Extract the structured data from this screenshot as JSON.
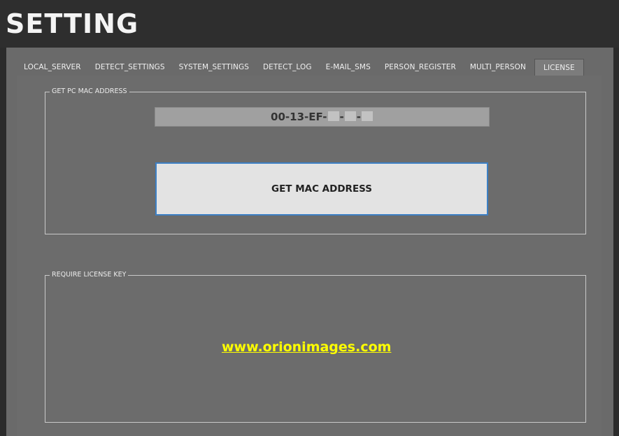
{
  "app": {
    "title": "SETTING"
  },
  "tabs": [
    {
      "label": "LOCAL_SERVER"
    },
    {
      "label": "DETECT_SETTINGS"
    },
    {
      "label": "SYSTEM_SETTINGS"
    },
    {
      "label": "DETECT_LOG"
    },
    {
      "label": "E-MAIL_SMS"
    },
    {
      "label": "PERSON_REGISTER"
    },
    {
      "label": "MULTI_PERSON"
    },
    {
      "label": "LICENSE",
      "active": true
    }
  ],
  "mac_group": {
    "legend": "GET PC MAC ADDRESS",
    "mac_value_visible": "00-13-EF-",
    "mac_separators": [
      "-",
      "-"
    ],
    "button_label": "GET MAC ADDRESS"
  },
  "license_group": {
    "legend": "REQUIRE LICENSE KEY",
    "link_text": "www.orionimages.com"
  },
  "colors": {
    "background": "#6c6c6c",
    "title_bar": "#2e2e2e",
    "button_border": "#3c7fc4",
    "link": "#ffff00"
  }
}
